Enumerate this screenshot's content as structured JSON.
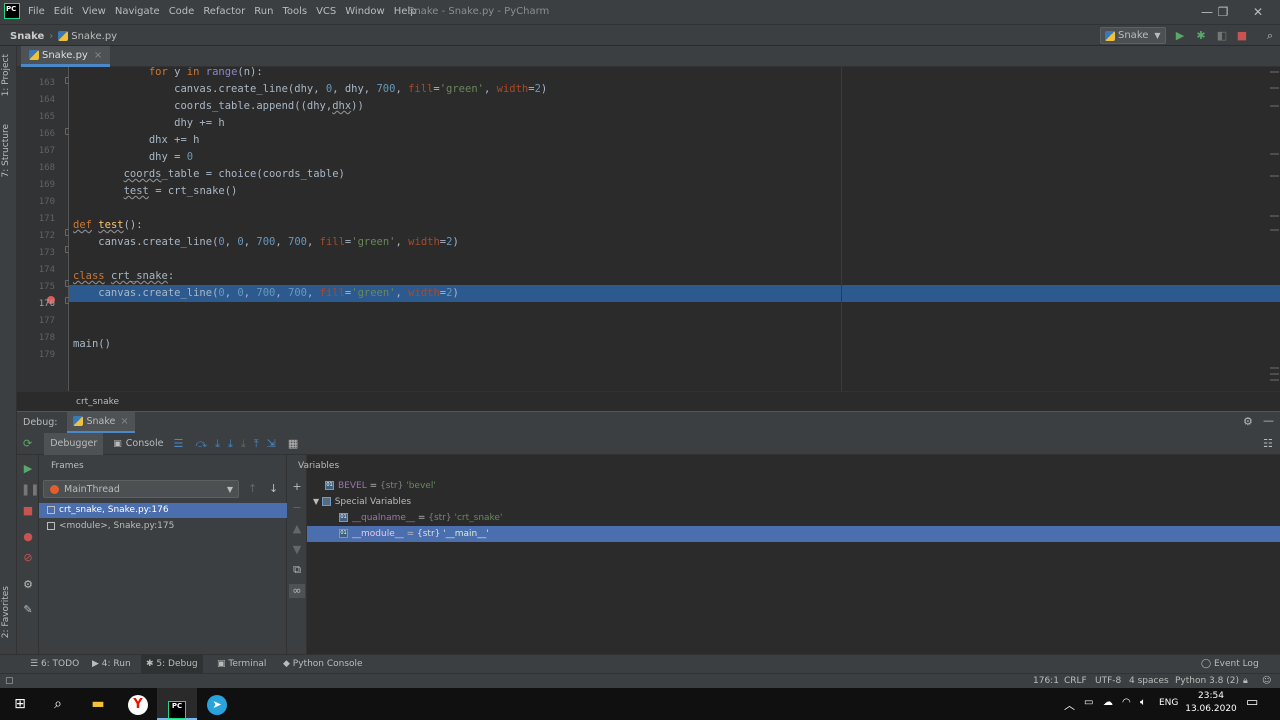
{
  "window": {
    "title": "Snake - Snake.py - PyCharm",
    "logo": "PC",
    "minimize": "—",
    "maximize": "❐",
    "close": "✕"
  },
  "menu": [
    "File",
    "Edit",
    "View",
    "Navigate",
    "Code",
    "Refactor",
    "Run",
    "Tools",
    "VCS",
    "Window",
    "Help"
  ],
  "navbar": {
    "project": "Snake",
    "file": "Snake.py",
    "run_config": "Snake"
  },
  "left_strip": {
    "project_tab": "1: Project",
    "structure_tab": "7: Structure",
    "favorites_tab": "2: Favorites"
  },
  "editor": {
    "tab_label": "Snake.py",
    "lines": [
      {
        "n": "163"
      },
      {
        "n": "164"
      },
      {
        "n": "165"
      },
      {
        "n": "166"
      },
      {
        "n": "167"
      },
      {
        "n": "168"
      },
      {
        "n": "169"
      },
      {
        "n": "170"
      },
      {
        "n": "171"
      },
      {
        "n": "172"
      },
      {
        "n": "173"
      },
      {
        "n": "174"
      },
      {
        "n": "175"
      },
      {
        "n": "176"
      },
      {
        "n": "177"
      },
      {
        "n": "178"
      },
      {
        "n": "179"
      }
    ],
    "breadcrumb": "crt_snake"
  },
  "debug": {
    "label": "Debug:",
    "session_tab": "Snake",
    "tab_debugger": "Debugger",
    "tab_console": "Console",
    "frames_title": "Frames",
    "variables_title": "Variables",
    "thread": "MainThread",
    "frames": [
      {
        "label": "crt_snake, Snake.py:176",
        "selected": true
      },
      {
        "label": "<module>, Snake.py:175",
        "selected": false
      }
    ],
    "variables": [
      {
        "name": "BEVEL",
        "type": "{str}",
        "value": "'bevel'",
        "indent": 0,
        "selected": false,
        "group": false
      },
      {
        "name": "Special Variables",
        "indent": 0,
        "selected": false,
        "group": true
      },
      {
        "name": "__qualname__",
        "type": "{str}",
        "value": "'crt_snake'",
        "indent": 1,
        "selected": false,
        "group": false
      },
      {
        "name": "__module__",
        "type": "{str}",
        "value": "'__main__'",
        "indent": 1,
        "selected": true,
        "group": false
      }
    ]
  },
  "toolwindows": {
    "todo": "6: TODO",
    "run": "4: Run",
    "debug": "5: Debug",
    "terminal": "Terminal",
    "python_console": "Python Console",
    "event_log": "Event Log"
  },
  "status": {
    "position": "176:1",
    "line_sep": "CRLF",
    "encoding": "UTF-8",
    "indent": "4 spaces",
    "interpreter": "Python 3.8 (2)"
  },
  "taskbar": {
    "lang": "ENG",
    "time": "23:54",
    "date": "13.06.2020"
  },
  "colors": {
    "exec_line": "#2d5a8e",
    "selection": "#4b6eaf",
    "breakpoint": "#db5c5c"
  }
}
